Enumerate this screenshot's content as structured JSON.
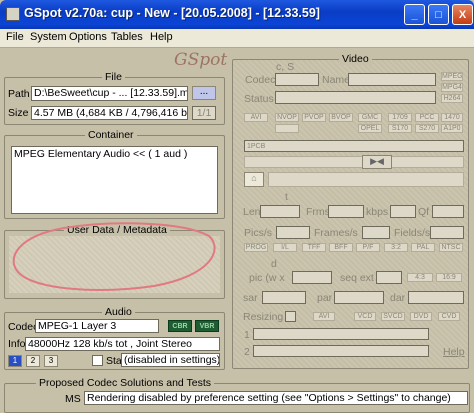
{
  "window": {
    "title": "GSpot v2.70a: cup - New - [20.05.2008] - [12.33.59]",
    "min": "_",
    "max": "□",
    "close": "X"
  },
  "menu": [
    "File",
    "System",
    "Options",
    "Tables",
    "Help"
  ],
  "logo": "GSpot",
  "file": {
    "legend": "File",
    "path_label": "Path",
    "path_value": "D:\\BeSweet\\cup - ... [12.33.59].mp3",
    "browse": "...",
    "size_label": "Size",
    "size_value": "4.57 MB (4,684 KB / 4,796,416 byt",
    "size_part": "1/1"
  },
  "container": {
    "legend": "Container",
    "value": "MPEG Elementary Audio << ( 1 aud )"
  },
  "metadata": {
    "legend": "User Data / Metadata"
  },
  "audio": {
    "legend": "Audio",
    "codec_label": "Codec",
    "codec_value": "MPEG-1 Layer 3",
    "cbr": "CBR",
    "vbr": "VBR",
    "info_label": "Info",
    "info_value": "48000Hz  128 kb/s tot , Joint Stereo",
    "stat_label": "Stat",
    "stat_value": "(disabled in settings)",
    "nav": [
      "1",
      "2",
      "3"
    ]
  },
  "proposed": {
    "legend": "Proposed Codec Solutions and Tests",
    "ms_label": "MS",
    "message": "Rendering disabled by preference setting (see \"Options > Settings\" to change)"
  },
  "video": {
    "legend": "Video",
    "cs_label": "c, S",
    "codec_label": "Codec",
    "name_label": "Name",
    "status_label": "Status",
    "top_tags": [
      "MPEG",
      "MPG4",
      "H264"
    ],
    "tag_row1": [
      "AVI",
      "NVOP",
      "PVOP",
      "BVOP",
      "GMC",
      "OPEL",
      "1709",
      "S170",
      "PCC",
      "S270",
      "1470",
      "A1P0"
    ],
    "type_label": "1PCB",
    "t_label": "t",
    "len_label": "Len",
    "frms_label": "Frms",
    "kbps_label": "kbps",
    "qf_label": "Qf",
    "pics_label": "Pics/s",
    "frames_label": "Frames/s",
    "fields_label": "Fields/s",
    "tag_row2": [
      "PROG",
      "I/L",
      "TFF",
      "BFF",
      "P/F",
      "3:2",
      "PAL",
      "NTSC"
    ],
    "d_label": "d",
    "pic_label": "pic (w x",
    "seq_label": "seq ext",
    "ratio1": "4:3",
    "ratio2": "16:9",
    "sar_label": "sar",
    "par_label": "par",
    "dar_label": "dar",
    "resizing_label": "Resizing",
    "resize_tags": [
      "AVI",
      "VCD",
      "SVCD",
      "DVD",
      "CVD"
    ],
    "row1": "1",
    "row2": "2",
    "help": "Help"
  }
}
